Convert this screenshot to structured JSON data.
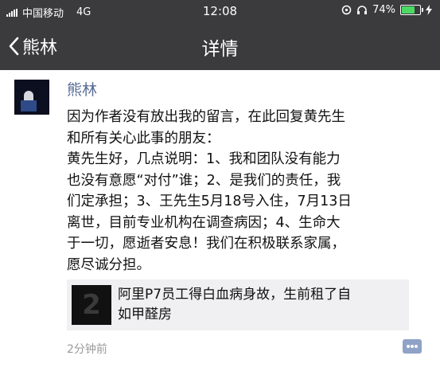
{
  "status_bar": {
    "carrier": "中国移动",
    "network": "4G",
    "time": "12:08",
    "battery": "74%",
    "battery_level_percent": 74
  },
  "nav": {
    "back_label": "熊林",
    "title": "详情"
  },
  "post": {
    "author": "熊林",
    "message": "因为作者没有放出我的留言，在此回复黄先生\n和所有关心此事的朋友：\n黄先生好，几点说明：1、我和团队没有能力\n也没有意愿“对付”谁；2、是我们的责任，我\n们定承担；3、王先生5月18号入住，7月13日\n离世，目前专业机构在调查病因；4、生命大\n于一切，愿逝者安息！我们在积极联系家属，\n愿尽诚分担。",
    "link": {
      "title": "阿里P7员工得白血病身故，生前租了自\n如甲醛房"
    },
    "timestamp": "2分钟前"
  },
  "colors": {
    "bar_background": "#3b3b3e",
    "author_name": "#576b95",
    "card_background": "#f0f0f2"
  },
  "icons": [
    "back-chevron-icon",
    "headphones-icon",
    "alarm-icon",
    "battery-icon",
    "comment-icon"
  ]
}
